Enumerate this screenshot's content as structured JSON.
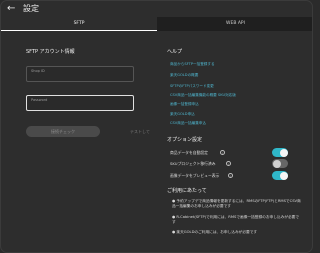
{
  "header": {
    "back_icon": "←",
    "title": "設定"
  },
  "tabs": [
    {
      "label": "SFTP"
    },
    {
      "label": "WEB API"
    }
  ],
  "sftp": {
    "heading": "SFTP アカウント情報",
    "user_placeholder": "Shop ID",
    "password_label": "Password",
    "connect_label": "接続チェック",
    "test_label": "テストして"
  },
  "help": {
    "heading": "ヘルプ",
    "links": [
      "商品からSFTP一括登録する",
      "楽天GOLDの概要",
      "SFTPのFTPパスワード変更",
      "CSV商品一括編集機能の概要 SKU対応版",
      "画像一括登録申込",
      "楽天GOLD申込",
      "CSV商品一括編集申込"
    ]
  },
  "options": {
    "heading": "オプション設定",
    "items": [
      {
        "label": "商品データを自動設定",
        "state": "on"
      },
      {
        "label": "SKUプロジェクト移行済み",
        "state": "off"
      },
      {
        "label": "画像データをプレビュー表示",
        "state": "on"
      }
    ]
  },
  "notes": {
    "heading": "ご利用にあたって",
    "items": [
      "● 予約アップデで商品情報を更新するには、RMSのFTP(FTP)とRMSでCSV商品一括編集のお申し込みが必要です",
      "● R-Cabinet(SFTP)で利用には、RMSで画像一括登録のお申し込みが必要です",
      "● 楽天GOLDのご利用には、お申し込みが必要です"
    ]
  },
  "colors": {
    "accent": "#2fb7c9",
    "link": "#4fb6cf",
    "background": "#2d2d2d"
  }
}
